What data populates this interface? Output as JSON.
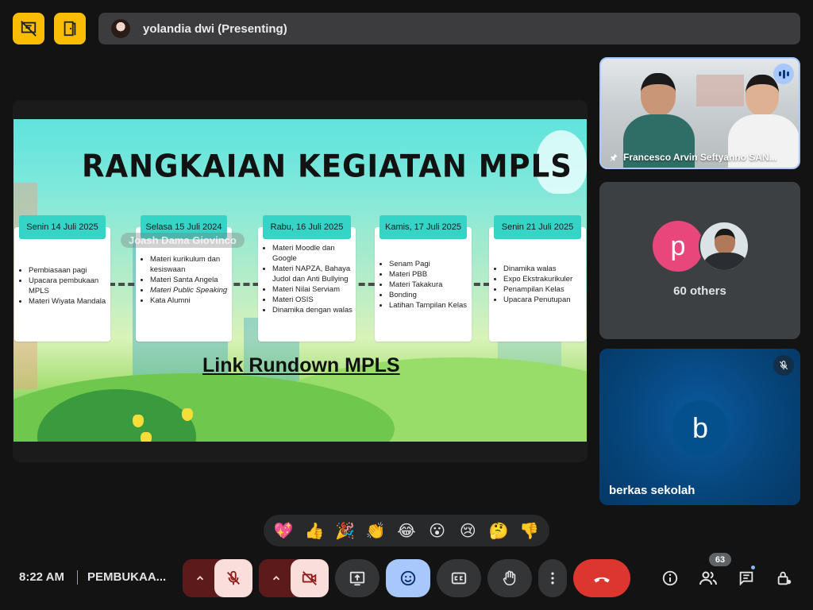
{
  "presenter": {
    "name": "yolandia dwi (Presenting)"
  },
  "slide": {
    "title": "RANGKAIAN KEGIATAN MPLS",
    "watermark": "Joash Dama Giovinco",
    "link": "Link Rundown MPLS",
    "days": [
      {
        "date": "Senin 14 Juli 2025",
        "items": [
          "Pembiasaan pagi",
          "Upacara pembukaan MPLS",
          "Materi Wiyata Mandala"
        ]
      },
      {
        "date": "Selasa 15 Juli 2024",
        "items": [
          "Materi kurikulum dan kesiswaan",
          "Materi Santa Angela",
          "Materi Public Speaking",
          "Kata Alumni"
        ]
      },
      {
        "date": "Rabu, 16 Juli 2025",
        "items": [
          "Materi Moodle dan Google",
          "Materi NAPZA, Bahaya Judol dan Anti Bullying",
          "Materi Nilai Serviam",
          "Materi OSIS",
          "Dinamika dengan walas"
        ]
      },
      {
        "date": "Kamis, 17 Juli 2025",
        "items": [
          "Senam Pagi",
          "Materi PBB",
          "Materi Takakura",
          "Bonding",
          "Latihan Tampilan Kelas"
        ]
      },
      {
        "date": "Senin  21 Juli 2025",
        "items": [
          "Dinamika walas",
          "Expo Ekstrakurikuler",
          "Penampilan Kelas",
          "Upacara Penutupan"
        ]
      }
    ]
  },
  "tiles": {
    "video_label": "Francesco Arvin Seftyanno SAN...",
    "others_label": "60 others",
    "others_avatar_letter": "p",
    "berkas_letter": "b",
    "berkas_label": "berkas sekolah"
  },
  "reactions": [
    "💖",
    "👍",
    "🎉",
    "👏",
    "😂",
    "😮",
    "😢",
    "🤔",
    "👎"
  ],
  "bottom": {
    "time": "8:22 AM",
    "meeting_name": "PEMBUKAA...",
    "participants_count": "63"
  },
  "colors": {
    "accent": "#a8c7fa",
    "end_call": "#dc362e",
    "warning": "#fbbc04"
  }
}
